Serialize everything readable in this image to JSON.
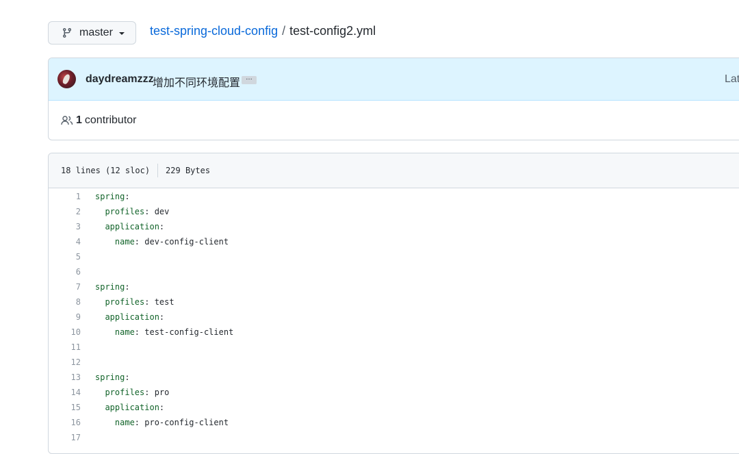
{
  "branch": {
    "label": "master",
    "icon": "git-branch-icon"
  },
  "breadcrumb": {
    "repo": "test-spring-cloud-config",
    "separator": "/",
    "file": "test-config2.yml"
  },
  "commit": {
    "author": "daydreamzzz",
    "message": "增加不同环境配置",
    "ellipsis": "…",
    "latest_label": "Lat"
  },
  "contributors": {
    "count": "1",
    "label": "contributor",
    "icon": "people-icon"
  },
  "file_info": {
    "lines": "18 lines (12 sloc)",
    "size": "229 Bytes"
  },
  "code_lines": [
    {
      "n": "1",
      "indent": "",
      "key": "spring",
      "value": ""
    },
    {
      "n": "2",
      "indent": "  ",
      "key": "profiles",
      "value": "dev"
    },
    {
      "n": "3",
      "indent": "  ",
      "key": "application",
      "value": ""
    },
    {
      "n": "4",
      "indent": "    ",
      "key": "name",
      "value": "dev-config-client"
    },
    {
      "n": "5",
      "indent": "",
      "key": "",
      "value": ""
    },
    {
      "n": "6",
      "indent": "",
      "key": "",
      "value": ""
    },
    {
      "n": "7",
      "indent": "",
      "key": "spring",
      "value": ""
    },
    {
      "n": "8",
      "indent": "  ",
      "key": "profiles",
      "value": "test"
    },
    {
      "n": "9",
      "indent": "  ",
      "key": "application",
      "value": ""
    },
    {
      "n": "10",
      "indent": "    ",
      "key": "name",
      "value": "test-config-client"
    },
    {
      "n": "11",
      "indent": "",
      "key": "",
      "value": ""
    },
    {
      "n": "12",
      "indent": "",
      "key": "",
      "value": ""
    },
    {
      "n": "13",
      "indent": "",
      "key": "spring",
      "value": ""
    },
    {
      "n": "14",
      "indent": "  ",
      "key": "profiles",
      "value": "pro"
    },
    {
      "n": "15",
      "indent": "  ",
      "key": "application",
      "value": ""
    },
    {
      "n": "16",
      "indent": "    ",
      "key": "name",
      "value": "pro-config-client"
    },
    {
      "n": "17",
      "indent": "",
      "key": "",
      "value": ""
    }
  ],
  "colors": {
    "link": "#0969da",
    "yaml_key": "#116329",
    "commit_bg": "#ddf4ff"
  }
}
